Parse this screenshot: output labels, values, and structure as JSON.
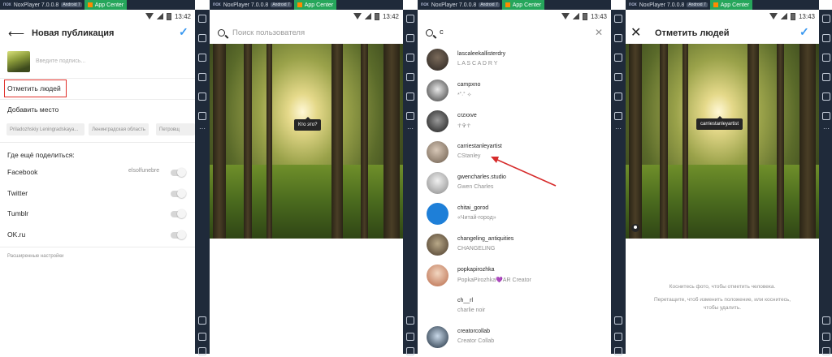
{
  "window": {
    "nox_logo": "nox",
    "title": "NoxPlayer 7.0.0.8",
    "android_badge": "Android 7",
    "app_center": "App Center"
  },
  "status_times": [
    "13:42",
    "13:42",
    "13:43",
    "13:43"
  ],
  "panel1": {
    "title": "Новая публикация",
    "caption_placeholder": "Введите подпись...",
    "tag_people": "Отметить людей",
    "add_location": "Добавить место",
    "location_chips": [
      "Priladozhskiy Leningradskaya...",
      "Ленинградская область",
      "Петровщ"
    ],
    "share_heading": "Где ещё поделиться:",
    "share_items": [
      {
        "label": "Facebook",
        "account": "elsolfunebre"
      },
      {
        "label": "Twitter"
      },
      {
        "label": "Tumblr"
      },
      {
        "label": "OK.ru"
      }
    ],
    "advanced": "Расширенные настройки"
  },
  "panel2": {
    "search_placeholder": "Поиск пользователя",
    "tooltip": "Кто это?"
  },
  "panel3": {
    "query": "c",
    "users": [
      {
        "username": "lascaleekallisterdry",
        "subtitle": "L A S C A   D R Y"
      },
      {
        "username": "campxno",
        "subtitle": "*˚·˚ ✧"
      },
      {
        "username": "crzxxve",
        "subtitle": "☥✞☥"
      },
      {
        "username": "carriestanleyartist",
        "subtitle": "CStanley"
      },
      {
        "username": "gwencharles.studio",
        "subtitle": "Gwen Charles"
      },
      {
        "username": "chitai_gorod",
        "subtitle": "«Читай-город»"
      },
      {
        "username": "changeling_antiquities",
        "subtitle": "CHANGELING"
      },
      {
        "username": "popkapirozhka",
        "subtitle": "PopkaPirozhka💜AR Creator"
      },
      {
        "username": "ch__rl",
        "subtitle": "charlie noir"
      },
      {
        "username": "creatorcollab",
        "subtitle": "Creator Collab"
      }
    ],
    "arrow_color": "#d62b2b"
  },
  "panel4": {
    "title": "Отметить людей",
    "tag_label": "carriestanleyartist",
    "hint_primary": "Коснитесь фото, чтобы отметить человека.",
    "hint_secondary": "Перетащите, чтоб изменить положение, или коснитесь, чтобы удалить."
  },
  "colors": {
    "accent_blue": "#3897f0",
    "highlight_red": "#e0302a",
    "sidebar": "#1f2a3a",
    "app_center_green": "#26a65b"
  }
}
